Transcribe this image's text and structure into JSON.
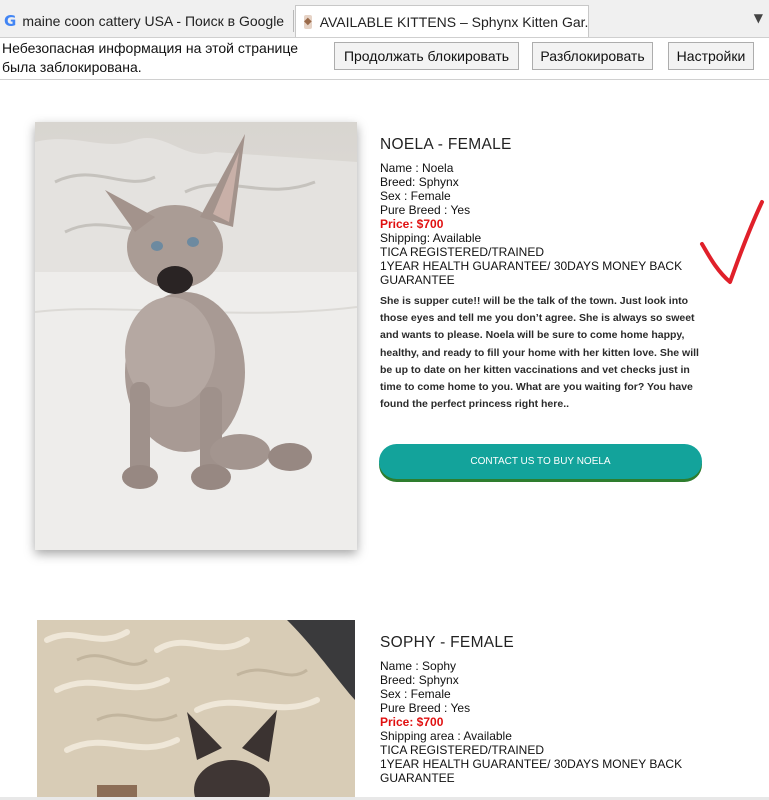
{
  "browser": {
    "tabs": [
      {
        "title": "maine coon cattery USA - Поиск в Google",
        "icon": "google-icon"
      },
      {
        "title": "AVAILABLE KITTENS – Sphynx Kitten Gar...",
        "icon": "cat-favicon"
      }
    ],
    "overflow_icon": "chevron-down-icon"
  },
  "infobar": {
    "message": "Небезопасная информация на этой странице была заблокирована.",
    "buttons": [
      "Продолжать блокировать",
      "Разблокировать",
      "Настройки"
    ]
  },
  "kittens": [
    {
      "heading": "NOELA - FEMALE",
      "name_line": "Name : Noela",
      "breed_line": "Breed: Sphynx",
      "sex_line": "Sex : Female",
      "pure_line": "Pure Breed : Yes",
      "price_line": "Price: $700",
      "shipping_line": "Shipping: Available",
      "tica_line": "TICA REGISTERED/TRAINED",
      "guarantee_line_1": "1YEAR HEALTH GUARANTEE/ 30DAYS MONEY BACK",
      "guarantee_line_2": "GUARANTEE",
      "description": "She is supper cute!! will be the talk of the town. Just look into those eyes and tell me you don’t agree. She is always so sweet and wants to please. Noela will be sure to come home happy, healthy, and ready to fill your home with her kitten love. She will be up to date on her kitten vaccinations and vet checks just in time to come home to you. What are you waiting for? You have found the perfect princess right here..",
      "cta": "CONTACT US TO BUY NOELA"
    },
    {
      "heading": "SOPHY - FEMALE",
      "name_line": "Name : Sophy",
      "breed_line": "Breed: Sphynx",
      "sex_line": "Sex : Female",
      "pure_line": "Pure Breed : Yes",
      "price_line": "Price: $700",
      "shipping_line": "Shipping area : Available",
      "tica_line": "TICA REGISTERED/TRAINED",
      "guarantee_line_1": "1YEAR HEALTH GUARANTEE/ 30DAYS MONEY BACK",
      "guarantee_line_2": "GUARANTEE"
    }
  ],
  "colors": {
    "price": "#e01010",
    "cta": "#13a39b",
    "annotation": "#e0202a"
  },
  "annotation_icon": "checkmark-icon"
}
